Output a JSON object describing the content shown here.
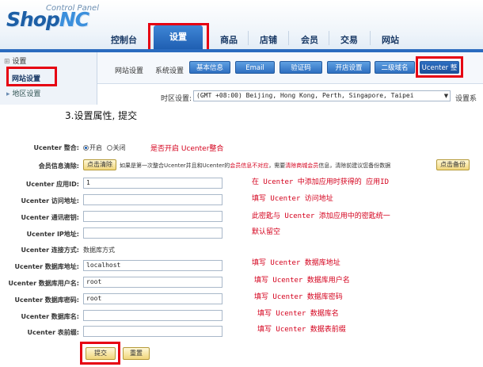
{
  "header": {
    "logo_text": "Shop",
    "logo_accent": "NC",
    "logo_sub": "Control Panel",
    "nav": [
      "控制台",
      "设置",
      "商品",
      "店铺",
      "会员",
      "交易",
      "网站"
    ],
    "nav_active": "设置"
  },
  "sidebar": {
    "heading": "设置",
    "items": [
      "网站设置",
      "地区设置"
    ]
  },
  "subnav": {
    "label1": "网站设置",
    "label2": "系统设置",
    "tabs": [
      "基本信息",
      "Email",
      "验证码",
      "开店设置",
      "二级域名",
      "Ucenter 整"
    ]
  },
  "timezone": {
    "label": "时区设置:",
    "value": "(GMT  +08:00)  Beijing,  Hong  Kong,  Perth,  Singapore,  Taipei",
    "right_text": "设置系"
  },
  "step_text": "3.设置属性, 提交",
  "form": {
    "ucenter_integrate": {
      "label": "Ucenter 整合:",
      "on": "开启",
      "off": "关闭",
      "note": "是否开启 Ucenter整合"
    },
    "clear_member": {
      "label": "会员信息清除:",
      "button": "点击清除",
      "desc_a": "如果是第一次整合Ucenter并且和Ucenter的",
      "desc_b": "会员信息不对应",
      "desc_c": "，需要",
      "desc_d": "清除商城会员",
      "desc_e": "信息，清除前建议您备份数据",
      "backup_button": "点击备份"
    },
    "fields": [
      {
        "label": "Ucenter 应用ID:",
        "value": "1",
        "note": "在 Ucenter 中添加应用时获得的 应用ID"
      },
      {
        "label": "Ucenter 访问地址:",
        "value": "",
        "note": "填写 Ucenter 访问地址"
      },
      {
        "label": "Ucenter 通讯密钥:",
        "value": "",
        "note": "此密匙与 Ucenter 添加应用中的密匙统一"
      },
      {
        "label": "Ucenter IP地址:",
        "value": "",
        "note": "默认留空"
      }
    ],
    "connect": {
      "label": "Ucenter 连接方式:",
      "value": "数据库方式"
    },
    "db_fields": [
      {
        "label": "Ucenter 数据库地址:",
        "value": "localhost",
        "note": "填写 Ucenter 数据库地址"
      },
      {
        "label": "Ucenter 数据库用户名:",
        "value": "root",
        "note": "填写 Ucenter 数据库用户名"
      },
      {
        "label": "Ucenter 数据库密码:",
        "value": "root",
        "note": "填写 Ucenter 数据库密码"
      },
      {
        "label": "Ucenter 数据库名:",
        "value": "",
        "note": "填写 Ucenter 数据库名"
      },
      {
        "label": "Ucenter 表前缀:",
        "value": "",
        "note": "填写 Ucenter 数据表前缀"
      }
    ],
    "submit": "提交",
    "reset": "重置"
  },
  "colors": {
    "accent": "#2a6bbf",
    "highlight": "#e60012",
    "note": "#d4001c"
  }
}
